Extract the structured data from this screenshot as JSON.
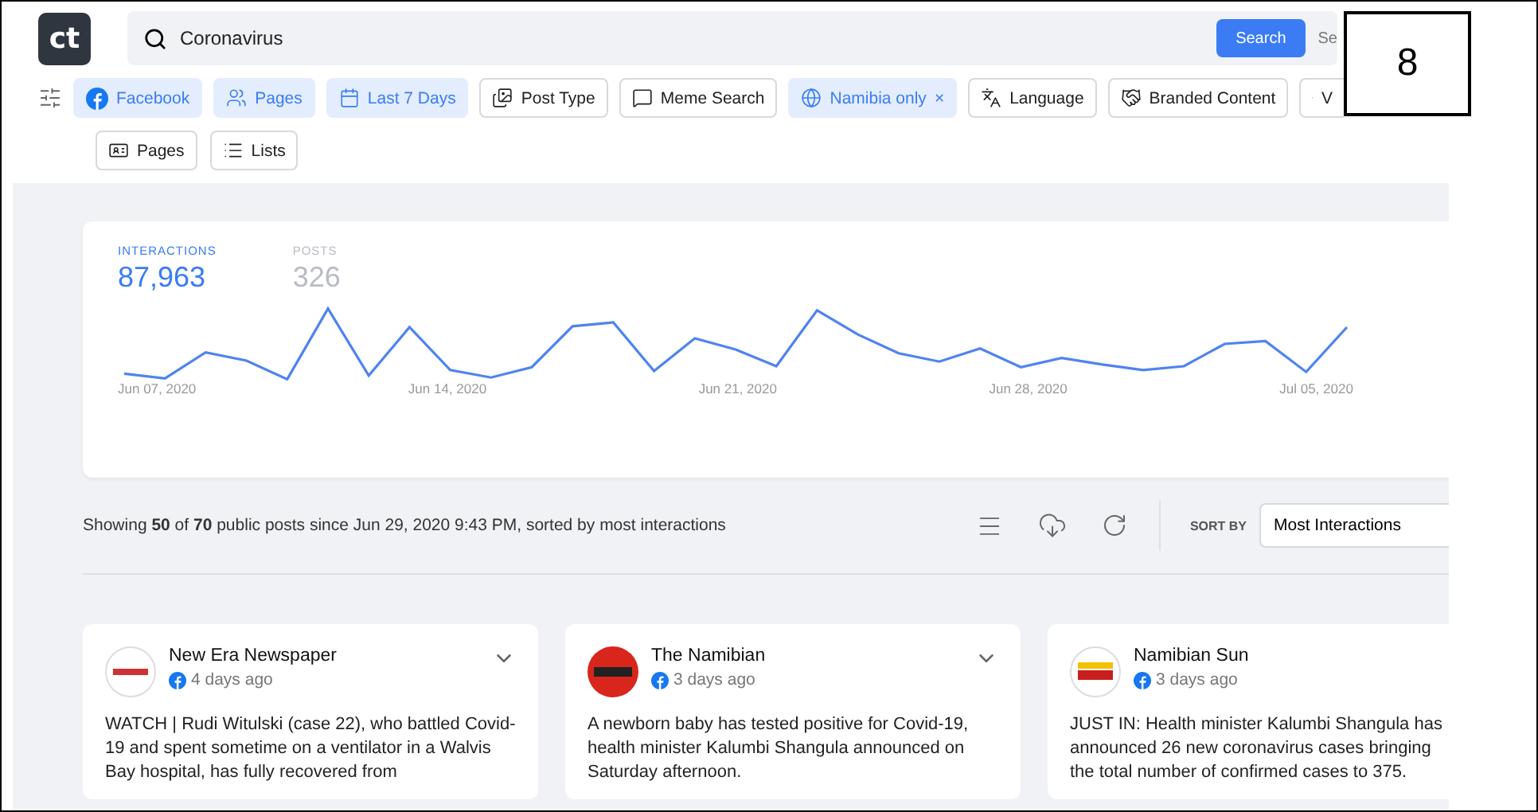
{
  "logo": {
    "text": "ct"
  },
  "search": {
    "value": "Coronavirus",
    "button": "Search",
    "extra": "Se"
  },
  "filters": [
    {
      "label": "Facebook",
      "selected": true,
      "removable": false
    },
    {
      "label": "Pages",
      "selected": true,
      "removable": false
    },
    {
      "label": "Last 7 Days",
      "selected": true,
      "removable": false
    },
    {
      "label": "Post Type",
      "selected": false,
      "removable": false
    },
    {
      "label": "Meme Search",
      "selected": false,
      "removable": false
    },
    {
      "label": "Namibia only",
      "selected": true,
      "removable": true,
      "remove": "×"
    },
    {
      "label": "Language",
      "selected": false,
      "removable": false
    },
    {
      "label": "Branded Content",
      "selected": false,
      "removable": false
    },
    {
      "label": "V",
      "selected": false,
      "removable": false
    }
  ],
  "filters_row2": [
    {
      "label": "Pages",
      "selected": false
    },
    {
      "label": "Lists",
      "selected": false
    }
  ],
  "overlay": {
    "text": "8"
  },
  "stats": [
    {
      "label": "INTERACTIONS",
      "value": "87,963",
      "selected": true
    },
    {
      "label": "POSTS",
      "value": "326",
      "selected": false
    }
  ],
  "chart": {
    "x_labels": [
      "Jun 07, 2020",
      "Jun 14, 2020",
      "Jun 21, 2020",
      "Jun 28, 2020",
      "Jul 05, 2020"
    ]
  },
  "summary": "Showing **50** of **70** public posts since Jun 29, 2020 9:43 PM, sorted by most interactions",
  "sort": {
    "label": "SORT BY",
    "value": "Most Interactions"
  },
  "posts": [
    {
      "source": "New Era Newspaper",
      "time": "4 days ago",
      "text": "WATCH | Rudi Witulski (case 22), who battled Covid-19 and spent sometime on a ventilator in a Walvis Bay hospital, has fully recovered from"
    },
    {
      "source": "The Namibian",
      "time": "3 days ago",
      "text": "A newborn baby has tested positive for Covid-19, health minister Kalumbi Shangula announced on Saturday afternoon."
    },
    {
      "source": "Namibian Sun",
      "time": "3 days ago",
      "text": "JUST IN: Health minister Kalumbi Shangula has announced 26 new coronavirus cases bringing the total number of confirmed cases to 375."
    }
  ]
}
